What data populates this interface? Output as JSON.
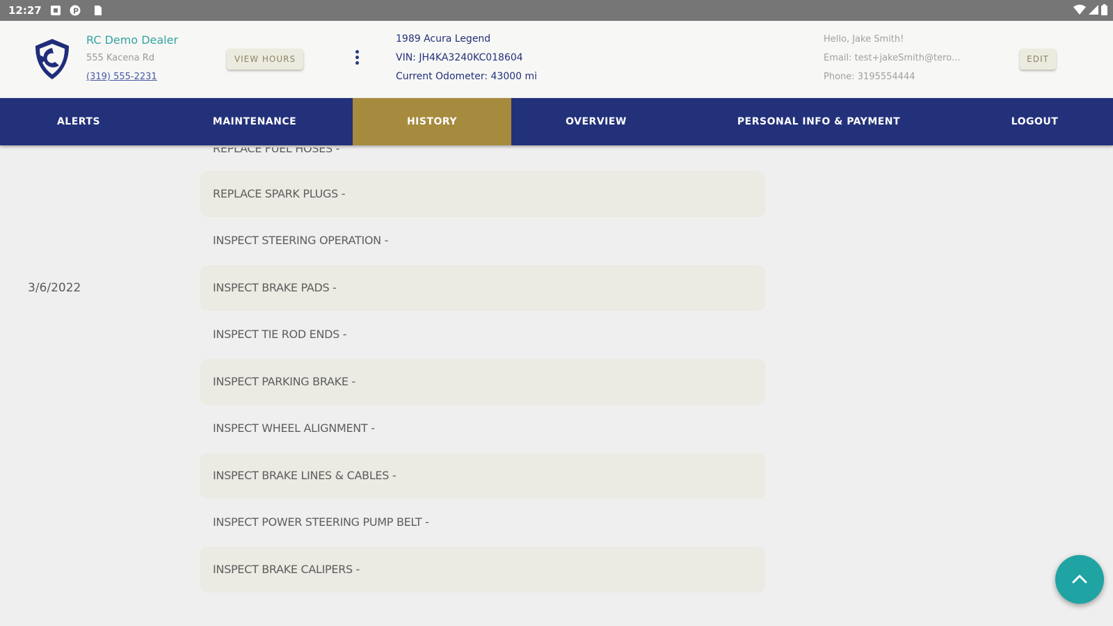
{
  "status_bar": {
    "time": "12:27"
  },
  "dealer": {
    "name": "RC Demo Dealer",
    "address": "555 Kacena Rd",
    "phone": "(319) 555-2231",
    "view_hours_label": "VIEW HOURS"
  },
  "vehicle": {
    "name": "1989 Acura Legend",
    "vin": "VIN: JH4KA3240KC018604",
    "odometer": "Current Odometer: 43000 mi"
  },
  "user": {
    "greeting": "Hello, Jake Smith!",
    "email": "Email: test+jakeSmith@tero...",
    "phone": "Phone: 3195554444",
    "edit_label": "EDIT"
  },
  "nav": {
    "items": [
      {
        "label": "ALERTS"
      },
      {
        "label": "MAINTENANCE"
      },
      {
        "label": "HISTORY"
      },
      {
        "label": "OVERVIEW"
      },
      {
        "label": "PERSONAL INFO & PAYMENT"
      },
      {
        "label": "LOGOUT"
      }
    ],
    "active": "HISTORY"
  },
  "history": {
    "partial_top_item": "REPLACE FUEL HOSES -",
    "date": "3/6/2022",
    "items": [
      "REPLACE SPARK PLUGS -",
      "INSPECT STEERING OPERATION -",
      "INSPECT BRAKE PADS -",
      "INSPECT TIE ROD ENDS -",
      "INSPECT PARKING BRAKE -",
      "INSPECT WHEEL ALIGNMENT -",
      "INSPECT BRAKE LINES & CABLES -",
      "INSPECT POWER STEERING PUMP BELT -",
      "INSPECT BRAKE CALIPERS -"
    ]
  },
  "colors": {
    "nav_bg": "#23307a",
    "nav_active": "#a68a3e",
    "accent_teal": "#1fa3a3",
    "row_shade": "#ebeae3"
  },
  "icons": {
    "fab": "chevron-up-icon",
    "logo": "shield-logo-icon"
  }
}
